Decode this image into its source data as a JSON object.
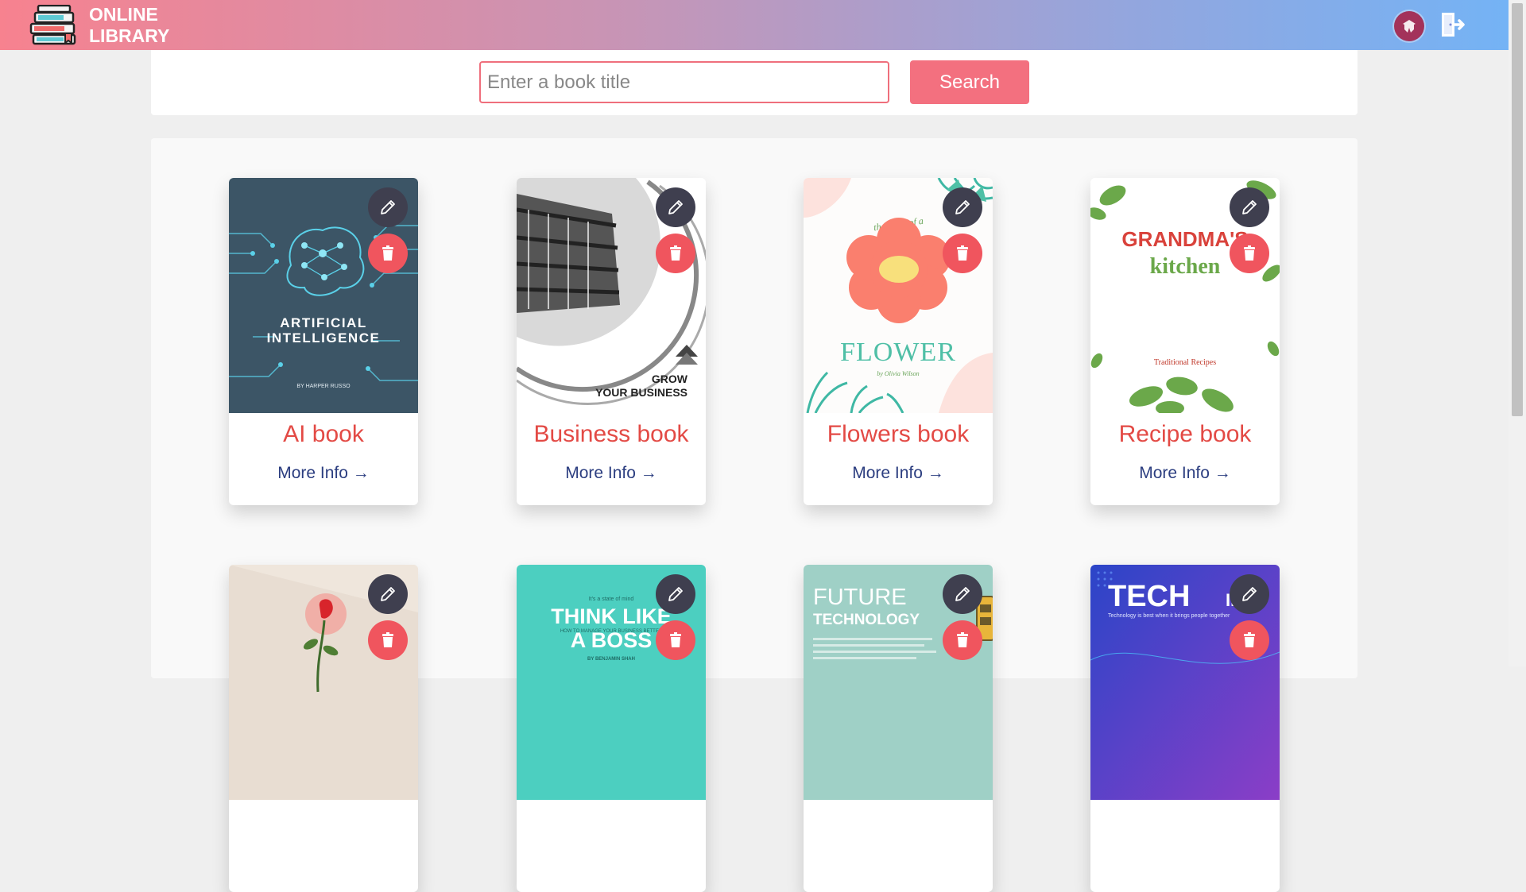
{
  "header": {
    "title_line1": "ONLINE",
    "title_line2": "LIBRARY",
    "logo_icon": "books-stack-icon",
    "avatar_icon": "user-avatar-icon",
    "logout_icon": "logout-door-icon",
    "gradient_colors": [
      "#f7828f",
      "#74b3f5"
    ]
  },
  "search": {
    "placeholder": "Enter a book title",
    "value": "",
    "button_label": "Search"
  },
  "colors": {
    "accent": "#f3707f",
    "title": "#e34a45",
    "link": "#2c3e80",
    "edit_button": "#3f3f4f",
    "delete_button": "#f0555e"
  },
  "books": [
    {
      "title": "AI book",
      "more_label": "More Info →",
      "cover": {
        "heading_line1": "ARTIFICIAL",
        "heading_line2": "INTELLIGENCE",
        "author": "BY HARPER RUSSO"
      }
    },
    {
      "title": "Business book",
      "more_label": "More Info →",
      "cover": {
        "heading_line1": "GROW",
        "heading_line2": "YOUR BUSINESS"
      }
    },
    {
      "title": "Flowers book",
      "more_label": "More Info →",
      "cover": {
        "tagline": "the story of a",
        "heading": "FLOWER",
        "author": "by Olivia Wilson"
      }
    },
    {
      "title": "Recipe book",
      "more_label": "More Info →",
      "cover": {
        "heading_line1": "GRANDMA'S",
        "heading_line2": "kitchen",
        "subtitle": "Traditional Recipes"
      }
    },
    {
      "title": "",
      "more_label": "",
      "cover": {}
    },
    {
      "title": "",
      "more_label": "",
      "cover": {
        "tagline": "It's a state of mind",
        "heading_line1": "THINK LIKE",
        "heading_line2": "A BOSS",
        "subtitle": "HOW TO MANAGE YOUR BUSINESS BETTER",
        "author": "BY BENJAMIN SHAH"
      }
    },
    {
      "title": "",
      "more_label": "",
      "cover": {
        "heading_line1": "FUTURE",
        "heading_line2": "TECHNOLOGY"
      }
    },
    {
      "title": "",
      "more_label": "",
      "cover": {
        "heading_line1": "TECH",
        "heading_line2": "IN",
        "subtitle": "Technology is best when it brings people together"
      }
    }
  ]
}
